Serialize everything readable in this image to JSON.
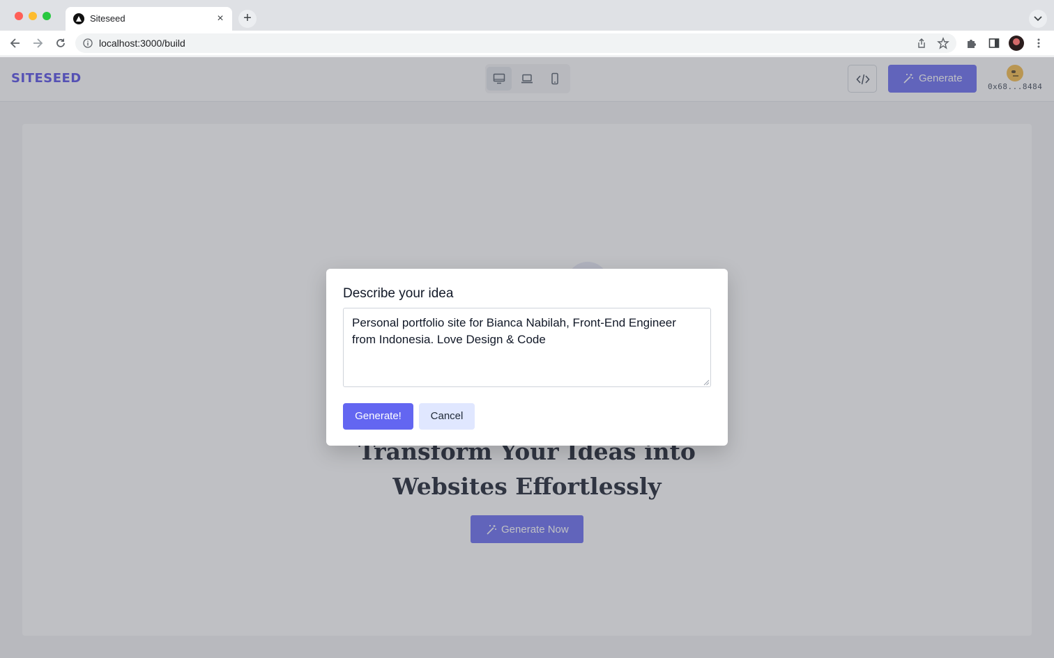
{
  "browser": {
    "tab_title": "Siteseed",
    "tab_close": "×",
    "new_tab": "+",
    "url": "localhost:3000/build"
  },
  "header": {
    "logo": "SITESEED",
    "devices": [
      "desktop-icon",
      "laptop-icon",
      "mobile-icon"
    ],
    "active_device": "desktop",
    "generate_label": "Generate",
    "wallet_address": "0x68...8484"
  },
  "hero": {
    "title_line1": "Transform Your Ideas into",
    "title_line2": "Websites Effortlessly",
    "cta_label": "Generate Now"
  },
  "modal": {
    "title": "Describe your idea",
    "input_value": "Personal portfolio site for Bianca Nabilah, Front-End Engineer from Indonesia. Love Design & Code",
    "generate_label": "Generate!",
    "cancel_label": "Cancel"
  },
  "colors": {
    "accent": "#6366f1",
    "logo": "#4f46e5",
    "overlay": "#5f616c"
  }
}
